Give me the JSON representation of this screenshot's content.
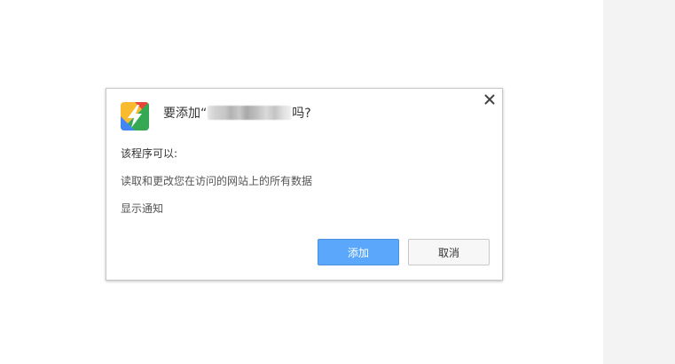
{
  "dialog": {
    "title_prefix": "要添加“",
    "title_suffix": "吗?",
    "permissions_heading": "该程序可以:",
    "permissions": [
      "读取和更改您在访问的网站上的所有数据",
      "显示通知"
    ],
    "add_label": "添加",
    "cancel_label": "取消",
    "close_symbol": "✕",
    "app_icon": "lightning-extension-icon"
  },
  "colors": {
    "accent": "#5aa7fb",
    "icon_red": "#e8453c",
    "icon_yellow": "#f9bb2d",
    "icon_green": "#34a853",
    "icon_blue": "#4285f4"
  }
}
